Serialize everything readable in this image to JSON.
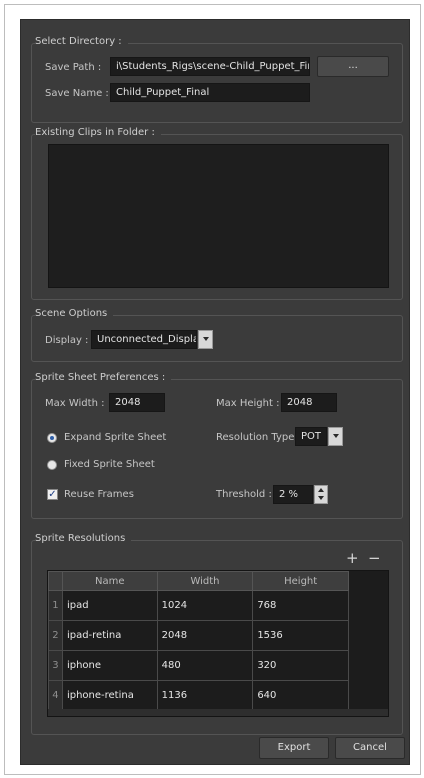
{
  "select_directory": {
    "title": "Select Directory :",
    "save_path_label": "Save Path :",
    "save_path_value": "i\\Students_Rigs\\scene-Child_Puppet_Final",
    "browse_label": "...",
    "save_name_label": "Save Name :",
    "save_name_value": "Child_Puppet_Final"
  },
  "existing_clips": {
    "title": "Existing Clips in Folder :"
  },
  "scene_options": {
    "title": "Scene Options",
    "display_label": "Display :",
    "display_value": "Unconnected_Display"
  },
  "sprite_sheet": {
    "title": "Sprite Sheet Preferences :",
    "max_width_label": "Max Width :",
    "max_width_value": "2048",
    "max_height_label": "Max Height :",
    "max_height_value": "2048",
    "expand_label": "Expand Sprite Sheet",
    "fixed_label": "Fixed Sprite Sheet",
    "selected_mode": "expand",
    "resolution_type_label": "Resolution Type",
    "resolution_type_value": "POT",
    "reuse_frames_label": "Reuse Frames",
    "reuse_frames_checked": true,
    "check_mark": "✓",
    "threshold_label": "Threshold :",
    "threshold_value": "2 %"
  },
  "sprite_resolutions": {
    "title": "Sprite Resolutions",
    "add_icon": "+",
    "remove_icon": "−",
    "columns": [
      "Name",
      "Width",
      "Height"
    ],
    "rows": [
      {
        "n": "1",
        "name": "ipad",
        "width": "1024",
        "height": "768"
      },
      {
        "n": "2",
        "name": "ipad-retina",
        "width": "2048",
        "height": "1536"
      },
      {
        "n": "3",
        "name": "iphone",
        "width": "480",
        "height": "320"
      },
      {
        "n": "4",
        "name": "iphone-retina",
        "width": "1136",
        "height": "640"
      }
    ]
  },
  "footer": {
    "export_label": "Export",
    "cancel_label": "Cancel"
  },
  "colors": {
    "dialog_bg": "#3b3b3b",
    "field_bg": "#1c1c1c",
    "accent_check": "#1f3f86"
  }
}
